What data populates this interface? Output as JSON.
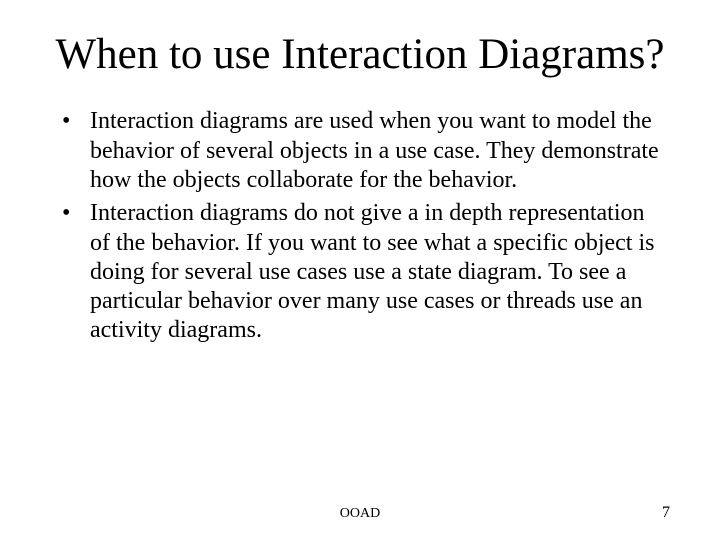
{
  "title": "When to use Interaction Diagrams?",
  "bullets": [
    "Interaction diagrams are used when you want to model the behavior of several objects in a use case.  They demonstrate how the objects collaborate for the behavior.",
    "Interaction diagrams do not give a in depth representation of the behavior.  If you want to see what a specific object is doing for several use cases use a state diagram.  To see a particular behavior over many use cases or threads use an activity diagrams."
  ],
  "footer": {
    "center": "OOAD",
    "page": "7"
  }
}
